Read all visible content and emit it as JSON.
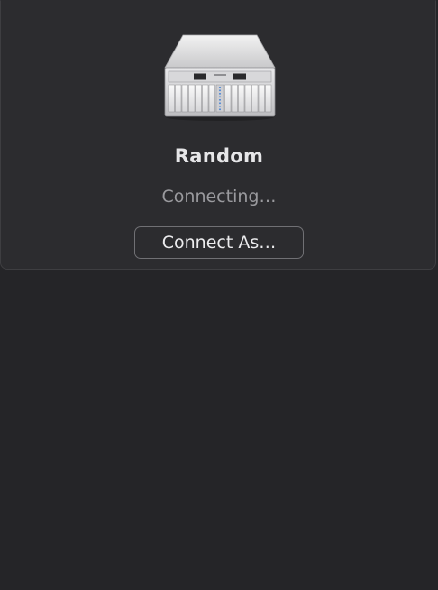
{
  "server": {
    "name": "Random",
    "icon": "server-rack-icon"
  },
  "status": {
    "text": "Connecting…"
  },
  "actions": {
    "connect_as_label": "Connect As…"
  }
}
